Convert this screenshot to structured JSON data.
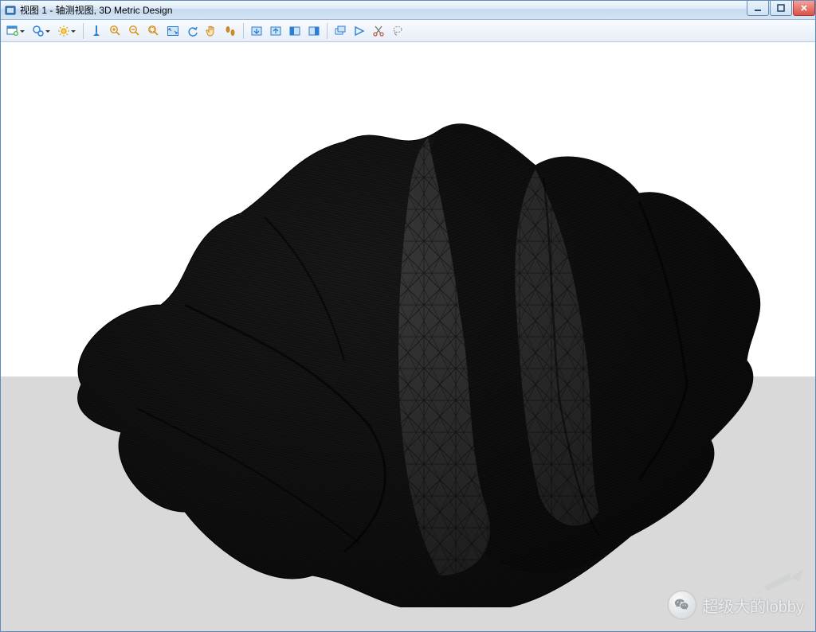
{
  "window": {
    "title": "视图 1 - 轴测视图, 3D Metric Design"
  },
  "toolbar": {
    "items": [
      "new-view",
      "point-select",
      "measure-light",
      "|",
      "measure-point",
      "zoom-in",
      "zoom-out",
      "zoom-window",
      "fit-view",
      "orbit",
      "pan",
      "walk",
      "|",
      "region-in",
      "region-out",
      "region-left",
      "region-right",
      "|",
      "layer-new",
      "layer-switch",
      "cut",
      "lasso"
    ]
  },
  "watermark": {
    "text": "超级大的lobby"
  }
}
